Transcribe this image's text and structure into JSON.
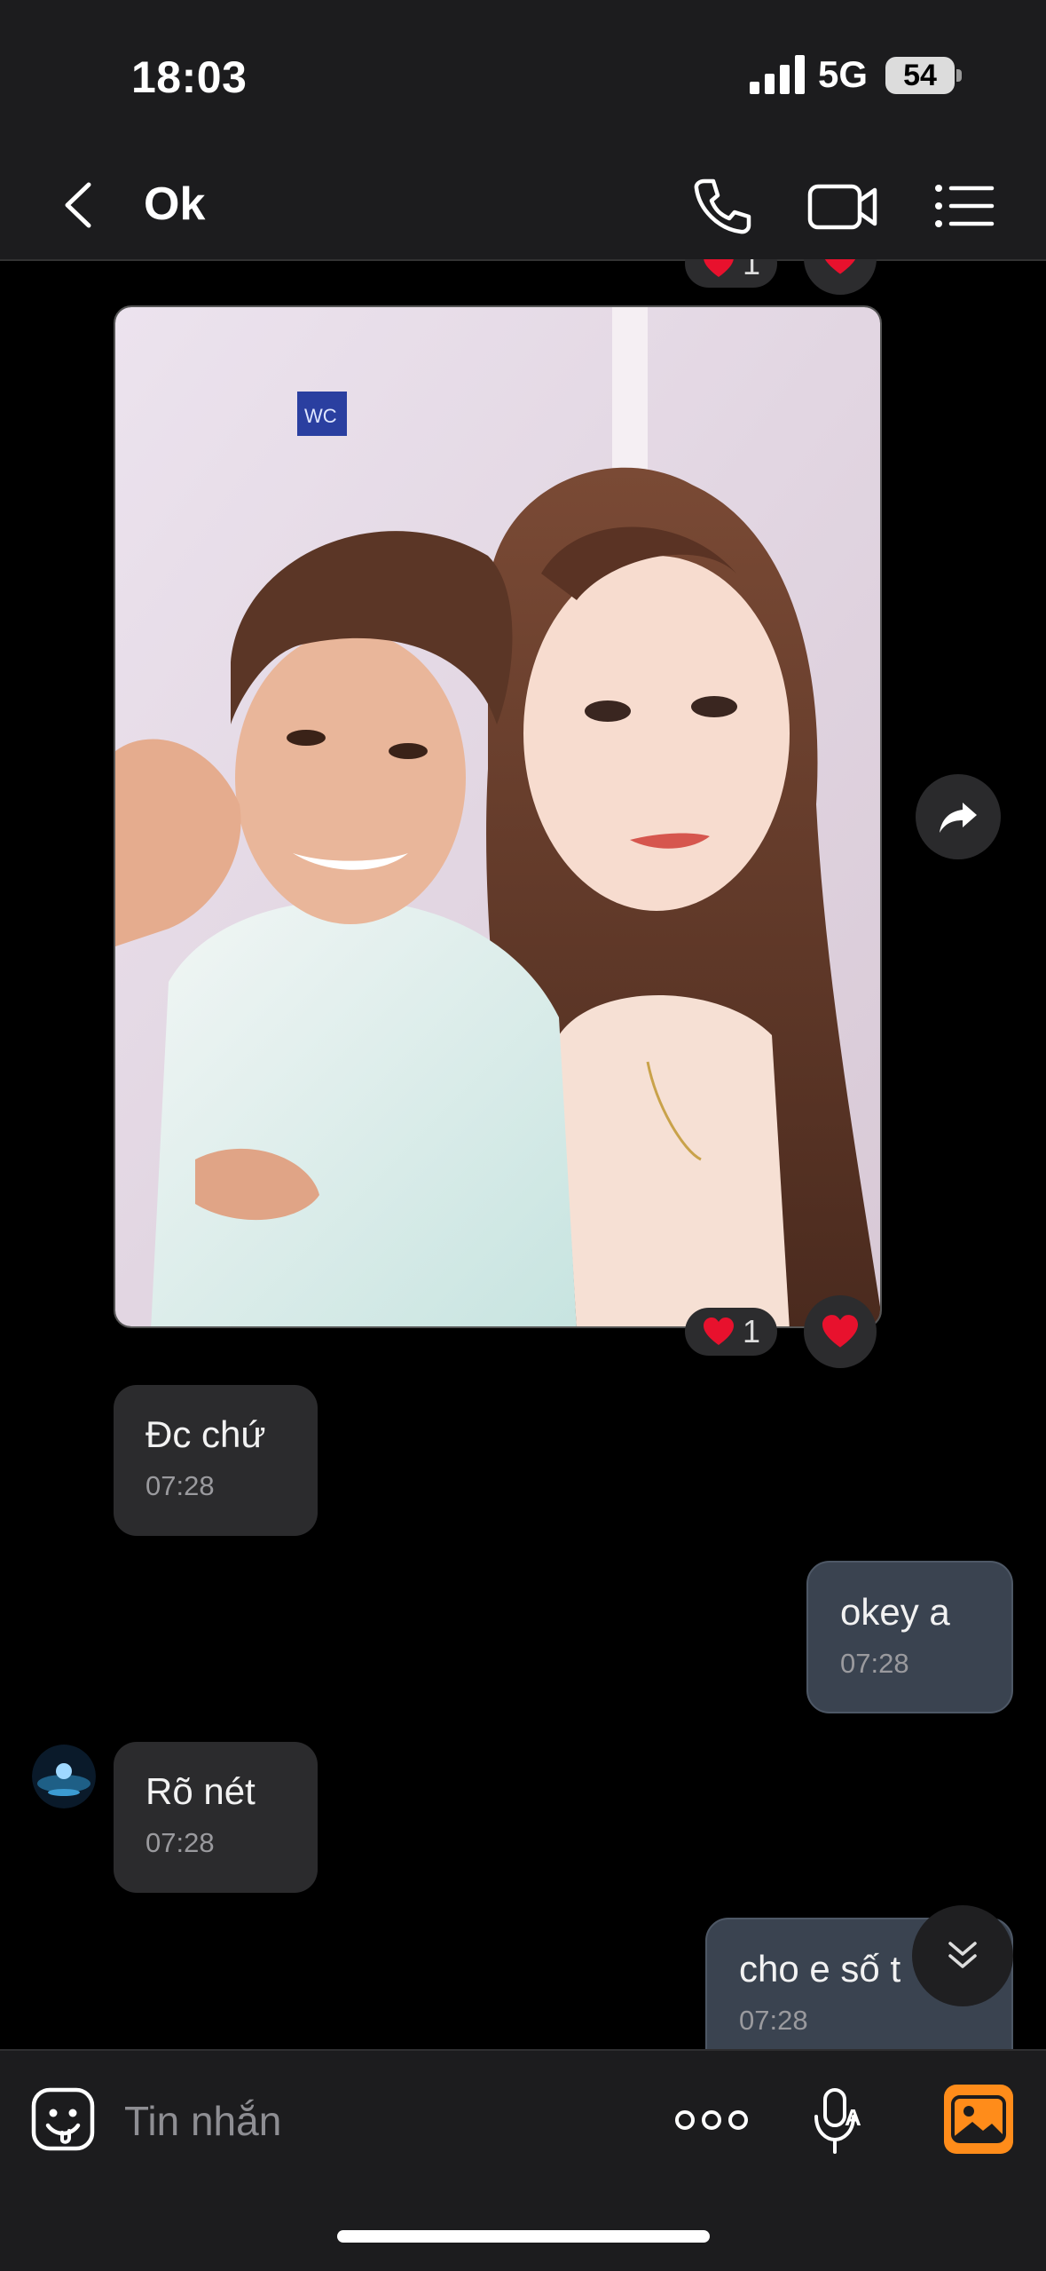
{
  "status": {
    "time": "18:03",
    "network": "5G",
    "battery": "54"
  },
  "header": {
    "title": "Ok",
    "back_icon": "chevron-left-icon",
    "call_icon": "phone-icon",
    "video_icon": "video-icon",
    "menu_icon": "list-icon"
  },
  "photo_message": {
    "reaction_count": "1"
  },
  "top_reaction": {
    "count": "1"
  },
  "messages": [
    {
      "direction": "in",
      "text": "Đc chứ",
      "time": "07:28"
    },
    {
      "direction": "out",
      "text": "okey a",
      "time": "07:28"
    },
    {
      "direction": "in",
      "text": "Rõ nét",
      "time": "07:28"
    },
    {
      "direction": "out",
      "text": "cho e số t",
      "time": "07:28"
    }
  ],
  "composer": {
    "placeholder": "Tin nhắn"
  },
  "colors": {
    "accent_orange": "#ff8c1a",
    "outgoing_bubble": "#3a4350",
    "incoming_bubble": "#2b2b2d",
    "heart": "#e8112d"
  }
}
